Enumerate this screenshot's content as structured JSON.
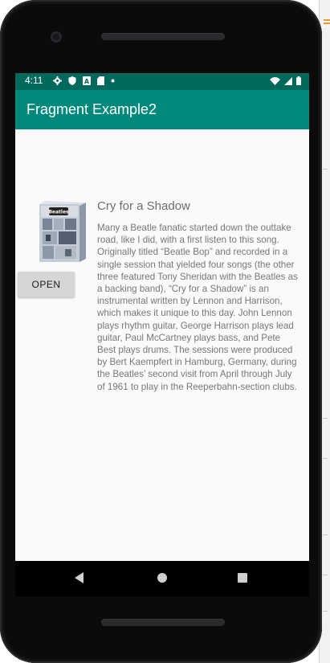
{
  "status_bar": {
    "time": "4:11",
    "left_icons": [
      "gear-icon",
      "shield-icon",
      "notification-a-icon",
      "sd-card-icon",
      "dot-icon"
    ],
    "right_icons": [
      "wifi-icon",
      "signal-icon",
      "battery-icon"
    ],
    "color": "#00695c"
  },
  "app_bar": {
    "title": "Fragment Example2",
    "color": "#00897b"
  },
  "content": {
    "album_image": "beatles-album-cover",
    "open_button_label": "OPEN",
    "song_title": "Cry for a Shadow",
    "song_description": "Many a Beatle fanatic started down the outtake road, like I did, with a first listen to this song. Originally titled “Beatle Bop” and recorded in a single session that yielded four songs (the other three featured Tony Sheridan with the Beatles as a backing band), “Cry for a Shadow” is an instrumental written by Lennon and Harrison, which makes it unique to this day. John Lennon plays rhythm guitar, George Harrison plays lead guitar, Paul McCartney plays bass, and Pete Best plays drums. The sessions were produced by Bert Kaempfert in Hamburg, Germany, during the Beatles’ second visit from April through July of 1961 to play in the Reeperbahn-section clubs."
  },
  "nav_bar": {
    "icons": [
      "back-icon",
      "home-icon",
      "recents-icon"
    ]
  }
}
